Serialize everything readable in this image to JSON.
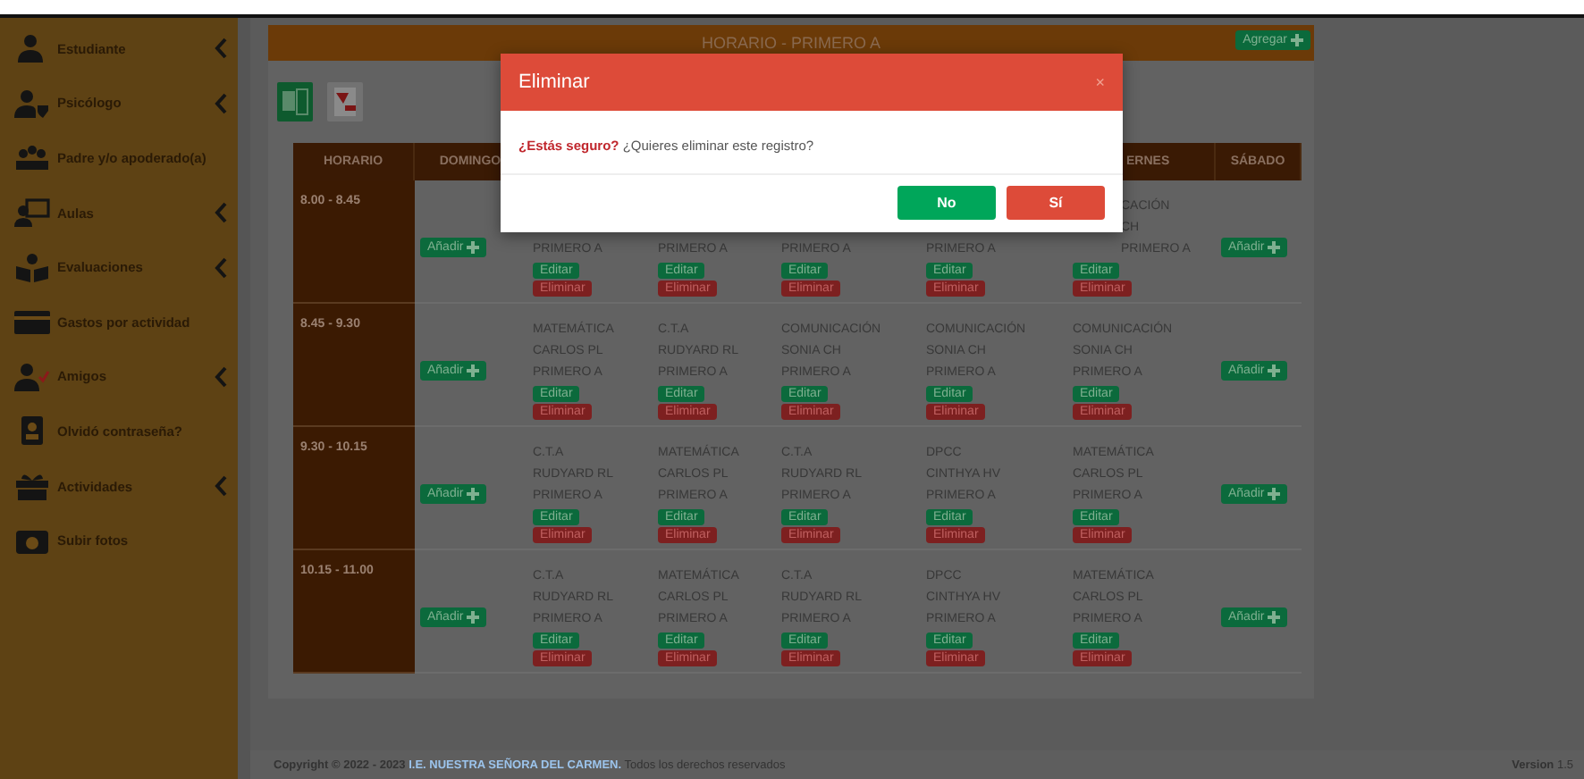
{
  "sidebar": {
    "items": [
      {
        "label": "Estudiante",
        "expandable": true
      },
      {
        "label": "Psicólogo",
        "expandable": true
      },
      {
        "label": "Padre y/o apoderado(a)",
        "expandable": false
      },
      {
        "label": "Aulas",
        "expandable": true
      },
      {
        "label": "Evaluaciones",
        "expandable": true
      },
      {
        "label": "Gastos por actividad",
        "expandable": false
      },
      {
        "label": "Amigos",
        "expandable": true
      },
      {
        "label": "Olvidó contraseña?",
        "expandable": false
      },
      {
        "label": "Actividades",
        "expandable": true
      },
      {
        "label": "Subir fotos",
        "expandable": false
      }
    ]
  },
  "schedule": {
    "title": "HORARIO - PRIMERO A",
    "add_button": "Agregar",
    "columns": [
      {
        "label": "HORARIO"
      },
      {
        "label": "DOMINGO"
      },
      {},
      {},
      {},
      {},
      {
        "label": "ERNES",
        "clipped": true
      },
      {
        "label": "SÁBADO"
      }
    ],
    "rows": [
      {
        "cells": [
          {
            "kind": "time",
            "label": "8.00 - 8.45"
          },
          {
            "kind": "add",
            "label": "Añadir"
          },
          {
            "kind": "class",
            "lines": [
              "PRIMERO A"
            ],
            "edit": "Editar",
            "delete": "Eliminar"
          },
          {
            "kind": "class",
            "lines": [
              "PRIMERO A"
            ],
            "edit": "Editar",
            "delete": "Eliminar"
          },
          {
            "kind": "class",
            "lines": [
              "PRIMERO A"
            ],
            "edit": "Editar",
            "delete": "Eliminar"
          },
          {
            "kind": "class",
            "lines": [
              "PRIMERO A"
            ],
            "edit": "Editar",
            "delete": "Eliminar"
          },
          {
            "kind": "class",
            "lines": [
              "CACIÓN",
              "CH",
              "PRIMERO A"
            ],
            "clipped": true,
            "edit": "Editar",
            "delete": "Eliminar"
          },
          {
            "kind": "add",
            "label": "Añadir"
          }
        ]
      },
      {
        "cells": [
          {
            "kind": "time",
            "label": "8.45 - 9.30"
          },
          {
            "kind": "add",
            "label": "Añadir"
          },
          {
            "kind": "class",
            "lines": [
              "MATEMÁTICA",
              "CARLOS PL",
              "PRIMERO A"
            ],
            "edit": "Editar",
            "delete": "Eliminar"
          },
          {
            "kind": "class",
            "lines": [
              "C.T.A",
              "RUDYARD RL",
              "PRIMERO A"
            ],
            "edit": "Editar",
            "delete": "Eliminar"
          },
          {
            "kind": "class",
            "lines": [
              "COMUNICACIÓN",
              "SONIA CH",
              "PRIMERO A"
            ],
            "edit": "Editar",
            "delete": "Eliminar"
          },
          {
            "kind": "class",
            "lines": [
              "COMUNICACIÓN",
              "SONIA CH",
              "PRIMERO A"
            ],
            "edit": "Editar",
            "delete": "Eliminar"
          },
          {
            "kind": "class",
            "lines": [
              "COMUNICACIÓN",
              "SONIA CH",
              "PRIMERO A"
            ],
            "edit": "Editar",
            "delete": "Eliminar"
          },
          {
            "kind": "add",
            "label": "Añadir"
          }
        ]
      },
      {
        "cells": [
          {
            "kind": "time",
            "label": "9.30 - 10.15"
          },
          {
            "kind": "add",
            "label": "Añadir"
          },
          {
            "kind": "class",
            "lines": [
              "C.T.A",
              "RUDYARD RL",
              "PRIMERO A"
            ],
            "edit": "Editar",
            "delete": "Eliminar"
          },
          {
            "kind": "class",
            "lines": [
              "MATEMÁTICA",
              "CARLOS PL",
              "PRIMERO A"
            ],
            "edit": "Editar",
            "delete": "Eliminar"
          },
          {
            "kind": "class",
            "lines": [
              "C.T.A",
              "RUDYARD RL",
              "PRIMERO A"
            ],
            "edit": "Editar",
            "delete": "Eliminar"
          },
          {
            "kind": "class",
            "lines": [
              "DPCC",
              "CINTHYA HV",
              "PRIMERO A"
            ],
            "edit": "Editar",
            "delete": "Eliminar"
          },
          {
            "kind": "class",
            "lines": [
              "MATEMÁTICA",
              "CARLOS PL",
              "PRIMERO A"
            ],
            "edit": "Editar",
            "delete": "Eliminar"
          },
          {
            "kind": "add",
            "label": "Añadir"
          }
        ]
      },
      {
        "cells": [
          {
            "kind": "time",
            "label": "10.15 - 11.00"
          },
          {
            "kind": "add",
            "label": "Añadir"
          },
          {
            "kind": "class",
            "lines": [
              "C.T.A",
              "RUDYARD RL",
              "PRIMERO A"
            ],
            "edit": "Editar",
            "delete": "Eliminar"
          },
          {
            "kind": "class",
            "lines": [
              "MATEMÁTICA",
              "CARLOS PL",
              "PRIMERO A"
            ],
            "edit": "Editar",
            "delete": "Eliminar"
          },
          {
            "kind": "class",
            "lines": [
              "C.T.A",
              "RUDYARD RL",
              "PRIMERO A"
            ],
            "edit": "Editar",
            "delete": "Eliminar"
          },
          {
            "kind": "class",
            "lines": [
              "DPCC",
              "CINTHYA HV",
              "PRIMERO A"
            ],
            "edit": "Editar",
            "delete": "Eliminar"
          },
          {
            "kind": "class",
            "lines": [
              "MATEMÁTICA",
              "CARLOS PL",
              "PRIMERO A"
            ],
            "edit": "Editar",
            "delete": "Eliminar"
          },
          {
            "kind": "add",
            "label": "Añadir"
          }
        ]
      }
    ]
  },
  "dialog": {
    "title": "Eliminar",
    "close": "×",
    "message": "**¿Estás seguro?** ¿Quieres eliminar este registro?",
    "buttons": [
      {
        "label": "No",
        "kind": "cancel"
      },
      {
        "label": "Sí",
        "kind": "confirm"
      }
    ]
  },
  "footer": {
    "copyright": "Copyright © 2022 - 2023",
    "link": "I.E. NUESTRA SEÑORA DEL CARMEN.",
    "rights": "Todos los derechos reservados",
    "version": "**Version** 1.5"
  }
}
